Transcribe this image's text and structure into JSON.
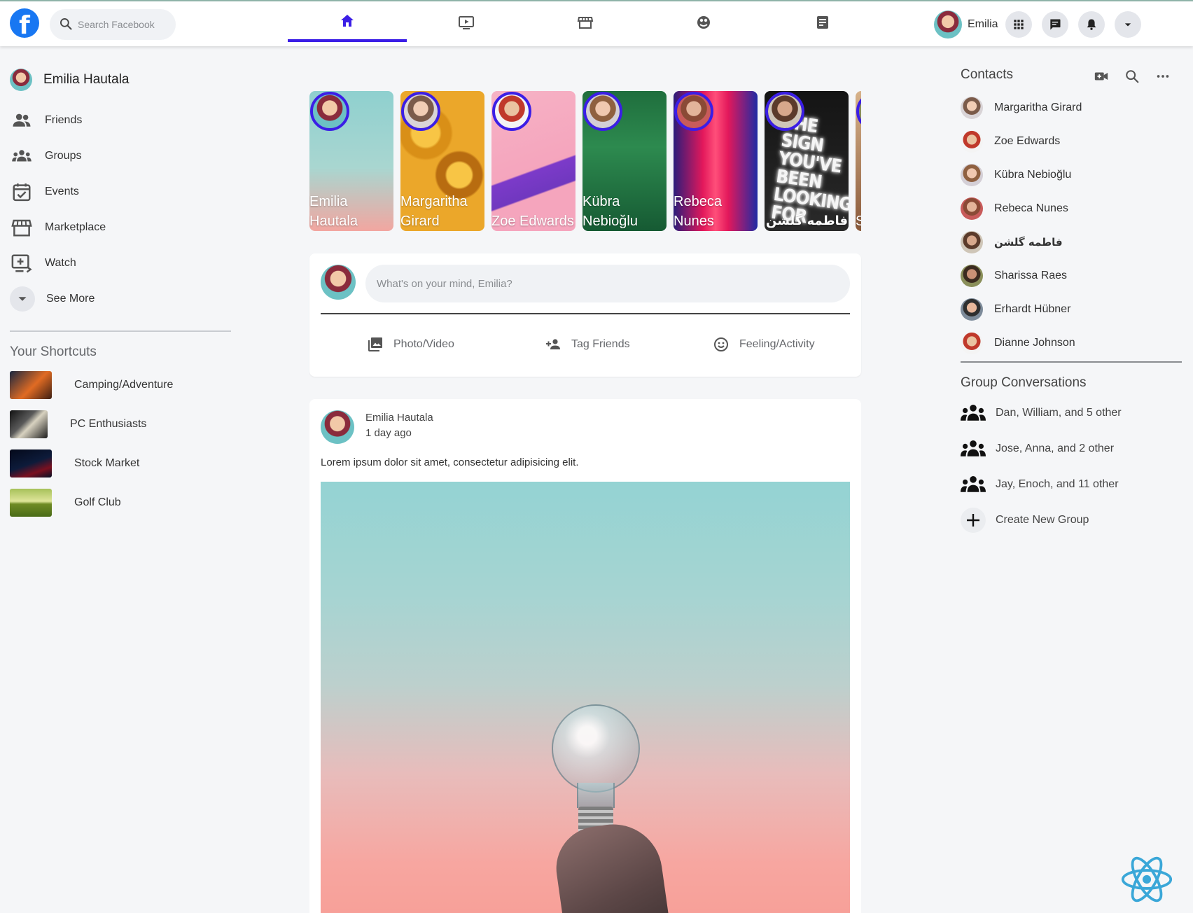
{
  "header": {
    "search_placeholder": "Search Facebook",
    "logo_letter": "f",
    "profile_name": "Emilia",
    "nav_tabs": [
      {
        "name": "home",
        "active": true
      },
      {
        "name": "watch",
        "active": false
      },
      {
        "name": "marketplace",
        "active": false
      },
      {
        "name": "groups",
        "active": false
      },
      {
        "name": "news",
        "active": false
      }
    ],
    "accent_color": "#3b1ee6"
  },
  "sidebar": {
    "user_name": "Emilia Hautala",
    "items": [
      {
        "label": "Friends",
        "icon": "friends-icon"
      },
      {
        "label": "Groups",
        "icon": "groups-icon"
      },
      {
        "label": "Events",
        "icon": "events-icon"
      },
      {
        "label": "Marketplace",
        "icon": "marketplace-icon"
      },
      {
        "label": "Watch",
        "icon": "watch-icon"
      },
      {
        "label": "See More",
        "icon": "chevron-down-icon"
      }
    ],
    "shortcuts_title": "Your Shortcuts",
    "shortcuts": [
      {
        "label": "Camping/Adventure"
      },
      {
        "label": "PC Enthusiasts"
      },
      {
        "label": "Stock Market"
      },
      {
        "label": "Golf Club"
      }
    ]
  },
  "stories": [
    {
      "name": "Emilia Hautala"
    },
    {
      "name": "Margaritha Girard"
    },
    {
      "name": "Zoe Edwards"
    },
    {
      "name": "Kübra Nebioğlu"
    },
    {
      "name": "Rebeca Nunes"
    },
    {
      "name": "فاطمه گلشن",
      "neon_text": "THE SIGN YOU'VE BEEN LOOKING FOR"
    },
    {
      "name": "S"
    }
  ],
  "composer": {
    "placeholder": "What's on your mind, Emilia?",
    "actions": [
      {
        "label": "Photo/Video",
        "icon": "photo-icon"
      },
      {
        "label": "Tag Friends",
        "icon": "add-person-icon"
      },
      {
        "label": "Feeling/Activity",
        "icon": "smiley-icon"
      }
    ]
  },
  "post": {
    "author": "Emilia Hautala",
    "time": "1 day ago",
    "text": "Lorem ipsum dolor sit amet, consectetur adipisicing elit."
  },
  "contacts": {
    "title": "Contacts",
    "items": [
      {
        "name": "Margaritha Girard"
      },
      {
        "name": "Zoe Edwards"
      },
      {
        "name": "Kübra Nebioğlu"
      },
      {
        "name": "Rebeca Nunes"
      },
      {
        "name": "فاطمه گلشن"
      },
      {
        "name": "Sharissa Raes"
      },
      {
        "name": "Erhardt Hübner"
      },
      {
        "name": "Dianne Johnson"
      }
    ]
  },
  "group_conversations": {
    "title": "Group Conversations",
    "items": [
      {
        "label": "Dan, William, and 5 other"
      },
      {
        "label": "Jose, Anna, and 2 other"
      },
      {
        "label": "Jay, Enoch, and 11 other"
      }
    ],
    "create_label": "Create New Group"
  }
}
